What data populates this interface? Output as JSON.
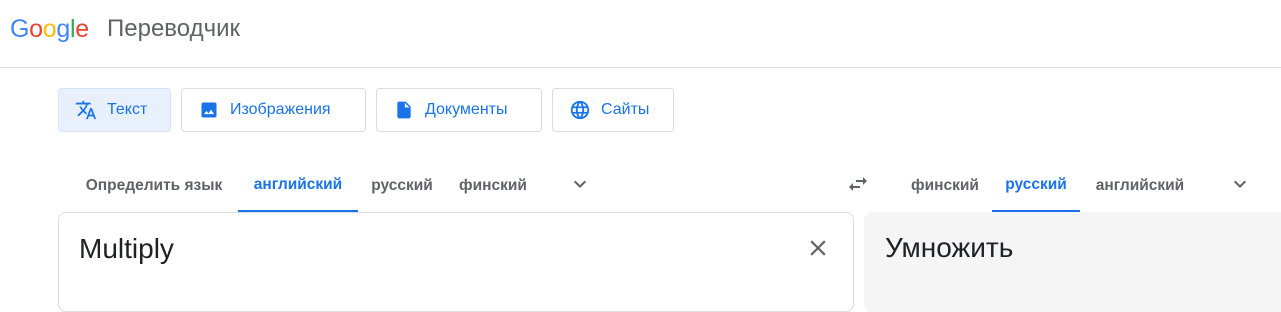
{
  "header": {
    "logo_letters": [
      "G",
      "o",
      "o",
      "g",
      "l",
      "e"
    ],
    "product_name": "Переводчик"
  },
  "modes": [
    {
      "label": "Текст",
      "icon": "translate-icon",
      "active": true
    },
    {
      "label": "Изображения",
      "icon": "image-icon",
      "active": false
    },
    {
      "label": "Документы",
      "icon": "document-icon",
      "active": false
    },
    {
      "label": "Сайты",
      "icon": "globe-icon",
      "active": false
    }
  ],
  "source_languages": {
    "detect": "Определить язык",
    "tabs": [
      "английский",
      "русский",
      "финский"
    ],
    "active": "английский"
  },
  "target_languages": {
    "tabs": [
      "финский",
      "русский",
      "английский"
    ],
    "active": "русский"
  },
  "source_text": "Multiply",
  "translation_text": "Умножить",
  "colors": {
    "accent": "#1a73e8",
    "active_bg": "#e8f0fe",
    "target_panel_bg": "#f5f5f5"
  }
}
